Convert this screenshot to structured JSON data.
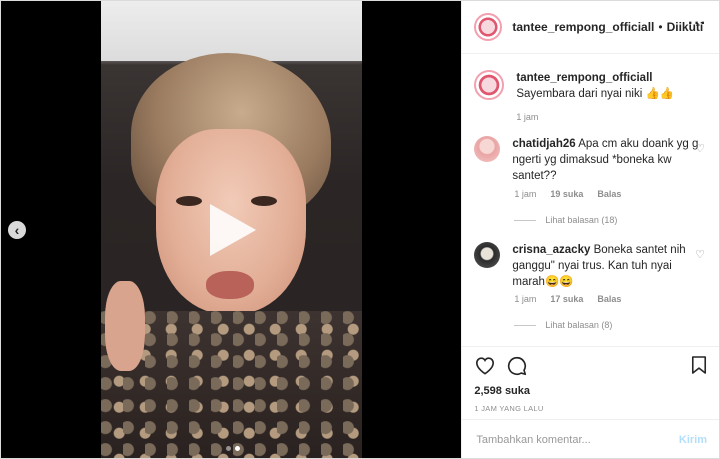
{
  "post": {
    "header": {
      "username": "tantee_rempong_officiall",
      "separator": "•",
      "follow_status": "Diikuti",
      "more_icon": "more-horizontal-icon"
    },
    "caption": {
      "username": "tantee_rempong_officiall",
      "text": "Sayembara dari nyai niki 👍👍",
      "time": "1 jam"
    },
    "comments": [
      {
        "username": "chatidjah26",
        "text": "Apa cm aku doank yg g ngerti yg dimaksud *boneka kw santet??",
        "time": "1 jam",
        "likes": "19 suka",
        "reply_label": "Balas",
        "view_replies": "Lihat balasan (18)"
      },
      {
        "username": "crisna_azacky",
        "text": "Boneka santet nih ganggu\" nyai trus. Kan tuh nyai marah😄😄",
        "time": "1 jam",
        "likes": "17 suka",
        "reply_label": "Balas",
        "view_replies": "Lihat balasan (8)"
      }
    ],
    "likes": "2,598 suka",
    "posted_ago": "1 JAM YANG LALU",
    "composer": {
      "placeholder": "Tambahkan komentar...",
      "send_label": "Kirim"
    }
  },
  "media": {
    "type": "video",
    "prev_icon": "chevron-left-icon",
    "play_icon": "play-icon",
    "carousel_index": 1,
    "carousel_count": 2
  },
  "colors": {
    "link_disabled": "#b2dffc",
    "muted": "#8e8e8e",
    "text": "#262626"
  }
}
